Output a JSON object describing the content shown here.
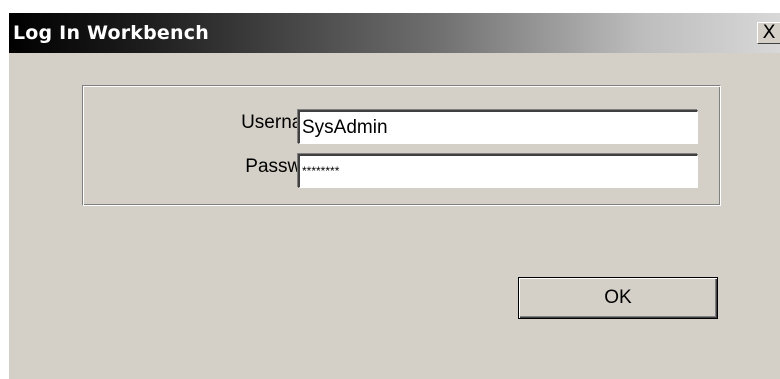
{
  "window": {
    "title": "Log In Workbench",
    "close_glyph": "X"
  },
  "form": {
    "username_label": "Username:",
    "username_value": "SysAdmin",
    "password_label": "Password:",
    "password_value": "********"
  },
  "buttons": {
    "ok_label": "OK"
  },
  "icons": {
    "close": "close-icon"
  }
}
